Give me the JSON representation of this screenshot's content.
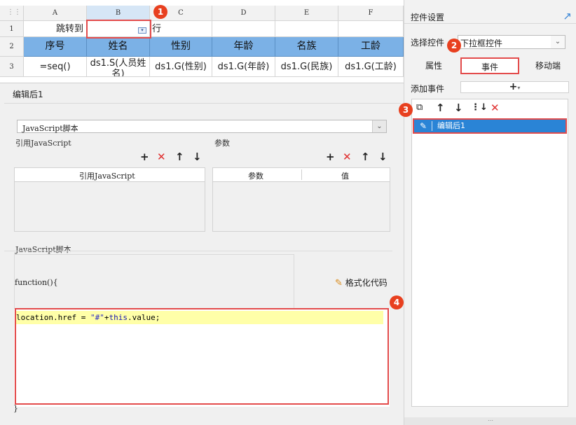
{
  "sheet": {
    "col_headers": [
      "A",
      "B",
      "C",
      "D",
      "E",
      "F"
    ],
    "row_headers": [
      "1",
      "2",
      "3"
    ],
    "row1": {
      "a": "跳转到",
      "c": "行"
    },
    "row2": [
      "序号",
      "姓名",
      "性别",
      "年龄",
      "名族",
      "工龄"
    ],
    "row3": [
      "=seq()",
      "ds1.S(人员姓名)",
      "ds1.G(性别)",
      "ds1.G(年龄)",
      "ds1.G(民族)",
      "ds1.G(工龄)"
    ]
  },
  "badges": [
    "1",
    "2",
    "3",
    "4"
  ],
  "editor": {
    "title": "编辑后1",
    "type_select": "JavaScript脚本",
    "ref_js_section": "引用JavaScript",
    "ref_js_column": "引用JavaScript",
    "params_section": "参数",
    "params_columns": [
      "参数",
      "值"
    ],
    "script_section": "JavaScript脚本",
    "function_open": "function(){",
    "format_button": "格式化代码",
    "code_plain": "location.href = ",
    "code_string": "\"#\"",
    "code_plus": "+",
    "code_this": "this",
    "code_rest": ".value;",
    "function_close": "}"
  },
  "right": {
    "title": "控件设置",
    "select_label": "选择控件",
    "select_value": "下拉框控件",
    "tabs": [
      "属性",
      "事件",
      "移动端"
    ],
    "add_event_label": "添加事件",
    "event_item": "编辑后1"
  },
  "colors": {
    "accent": "#2a84d6",
    "header_fill": "#7bb1e6",
    "highlight": "#e34b4b",
    "badge": "#e8401f"
  }
}
